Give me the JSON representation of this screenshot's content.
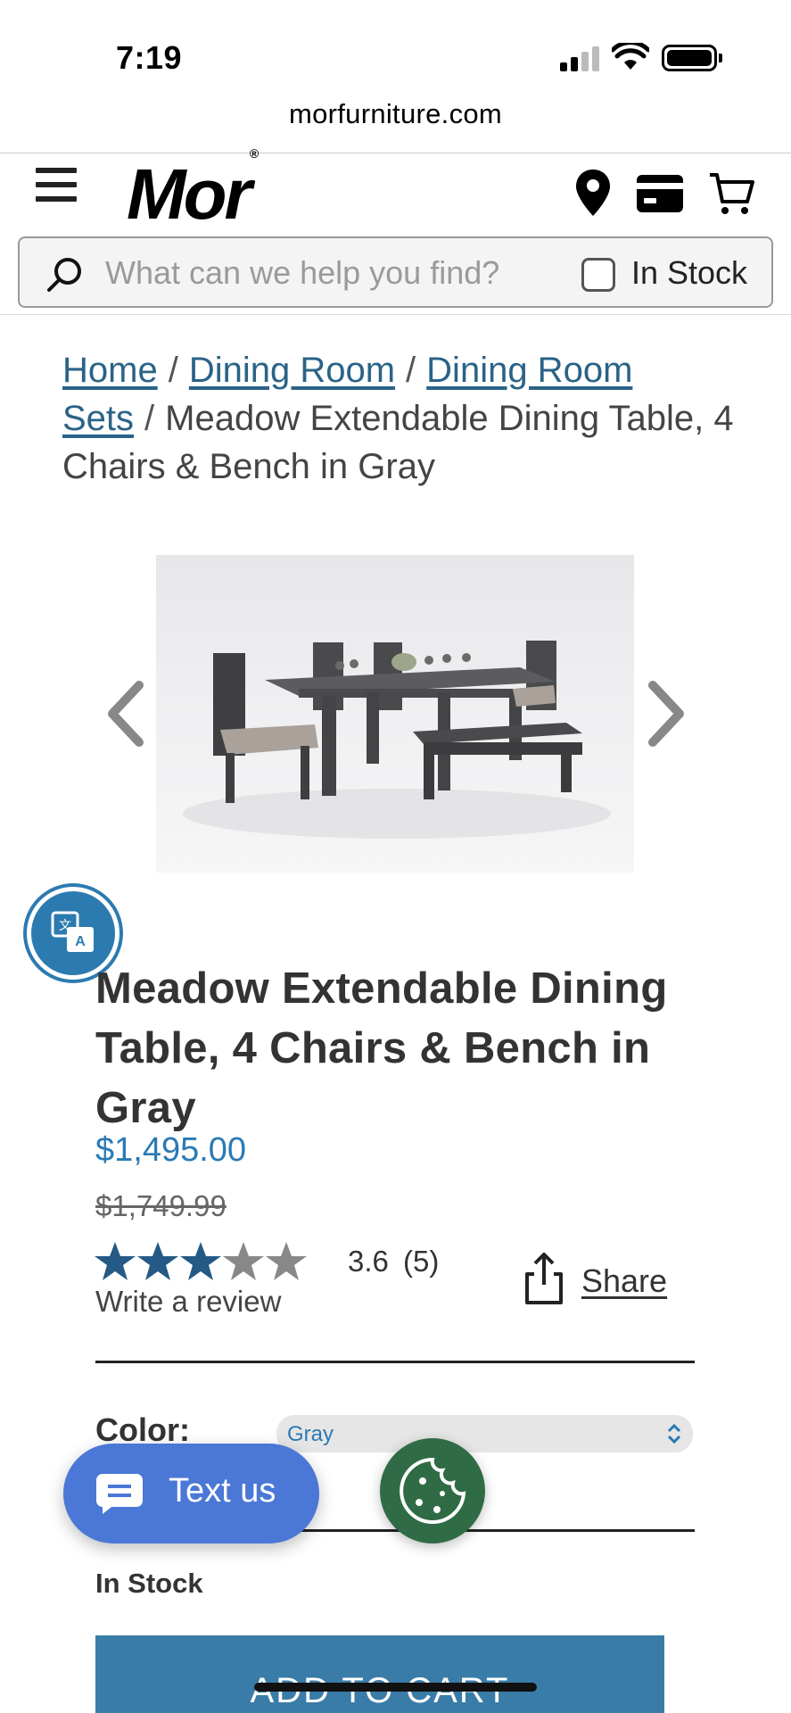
{
  "status_bar": {
    "time": "7:19"
  },
  "browser": {
    "url": "morfurniture.com"
  },
  "header": {
    "logo": "Mor",
    "search_placeholder": "What can we help you find?",
    "in_stock_label": "In Stock"
  },
  "breadcrumb": {
    "items": [
      "Home",
      "Dining Room",
      "Dining Room Sets"
    ],
    "current": "Meadow Extendable Dining Table, 4 Chairs & Bench in Gray"
  },
  "product": {
    "title": "Meadow Extendable Dining Table, 4 Chairs & Bench in Gray",
    "price": "$1,495.00",
    "original_price": "$1,749.99",
    "rating": "3.6",
    "rating_stars_filled": 3.6,
    "rating_stars_total": 5,
    "review_count": "(5)",
    "write_review": "Write a review",
    "share_label": "Share",
    "color_label": "Color:",
    "color_value": "Gray",
    "stock_status": "In Stock",
    "add_to_cart": "ADD TO CART"
  },
  "widgets": {
    "text_us": "Text us"
  },
  "colors": {
    "link": "#2a6387",
    "price": "#2a7ab4",
    "star": "#245a85",
    "text_us_bg": "#4b77d6",
    "cookie_bg": "#2f6b45",
    "add_to_cart_bg": "#3a7ca8"
  }
}
